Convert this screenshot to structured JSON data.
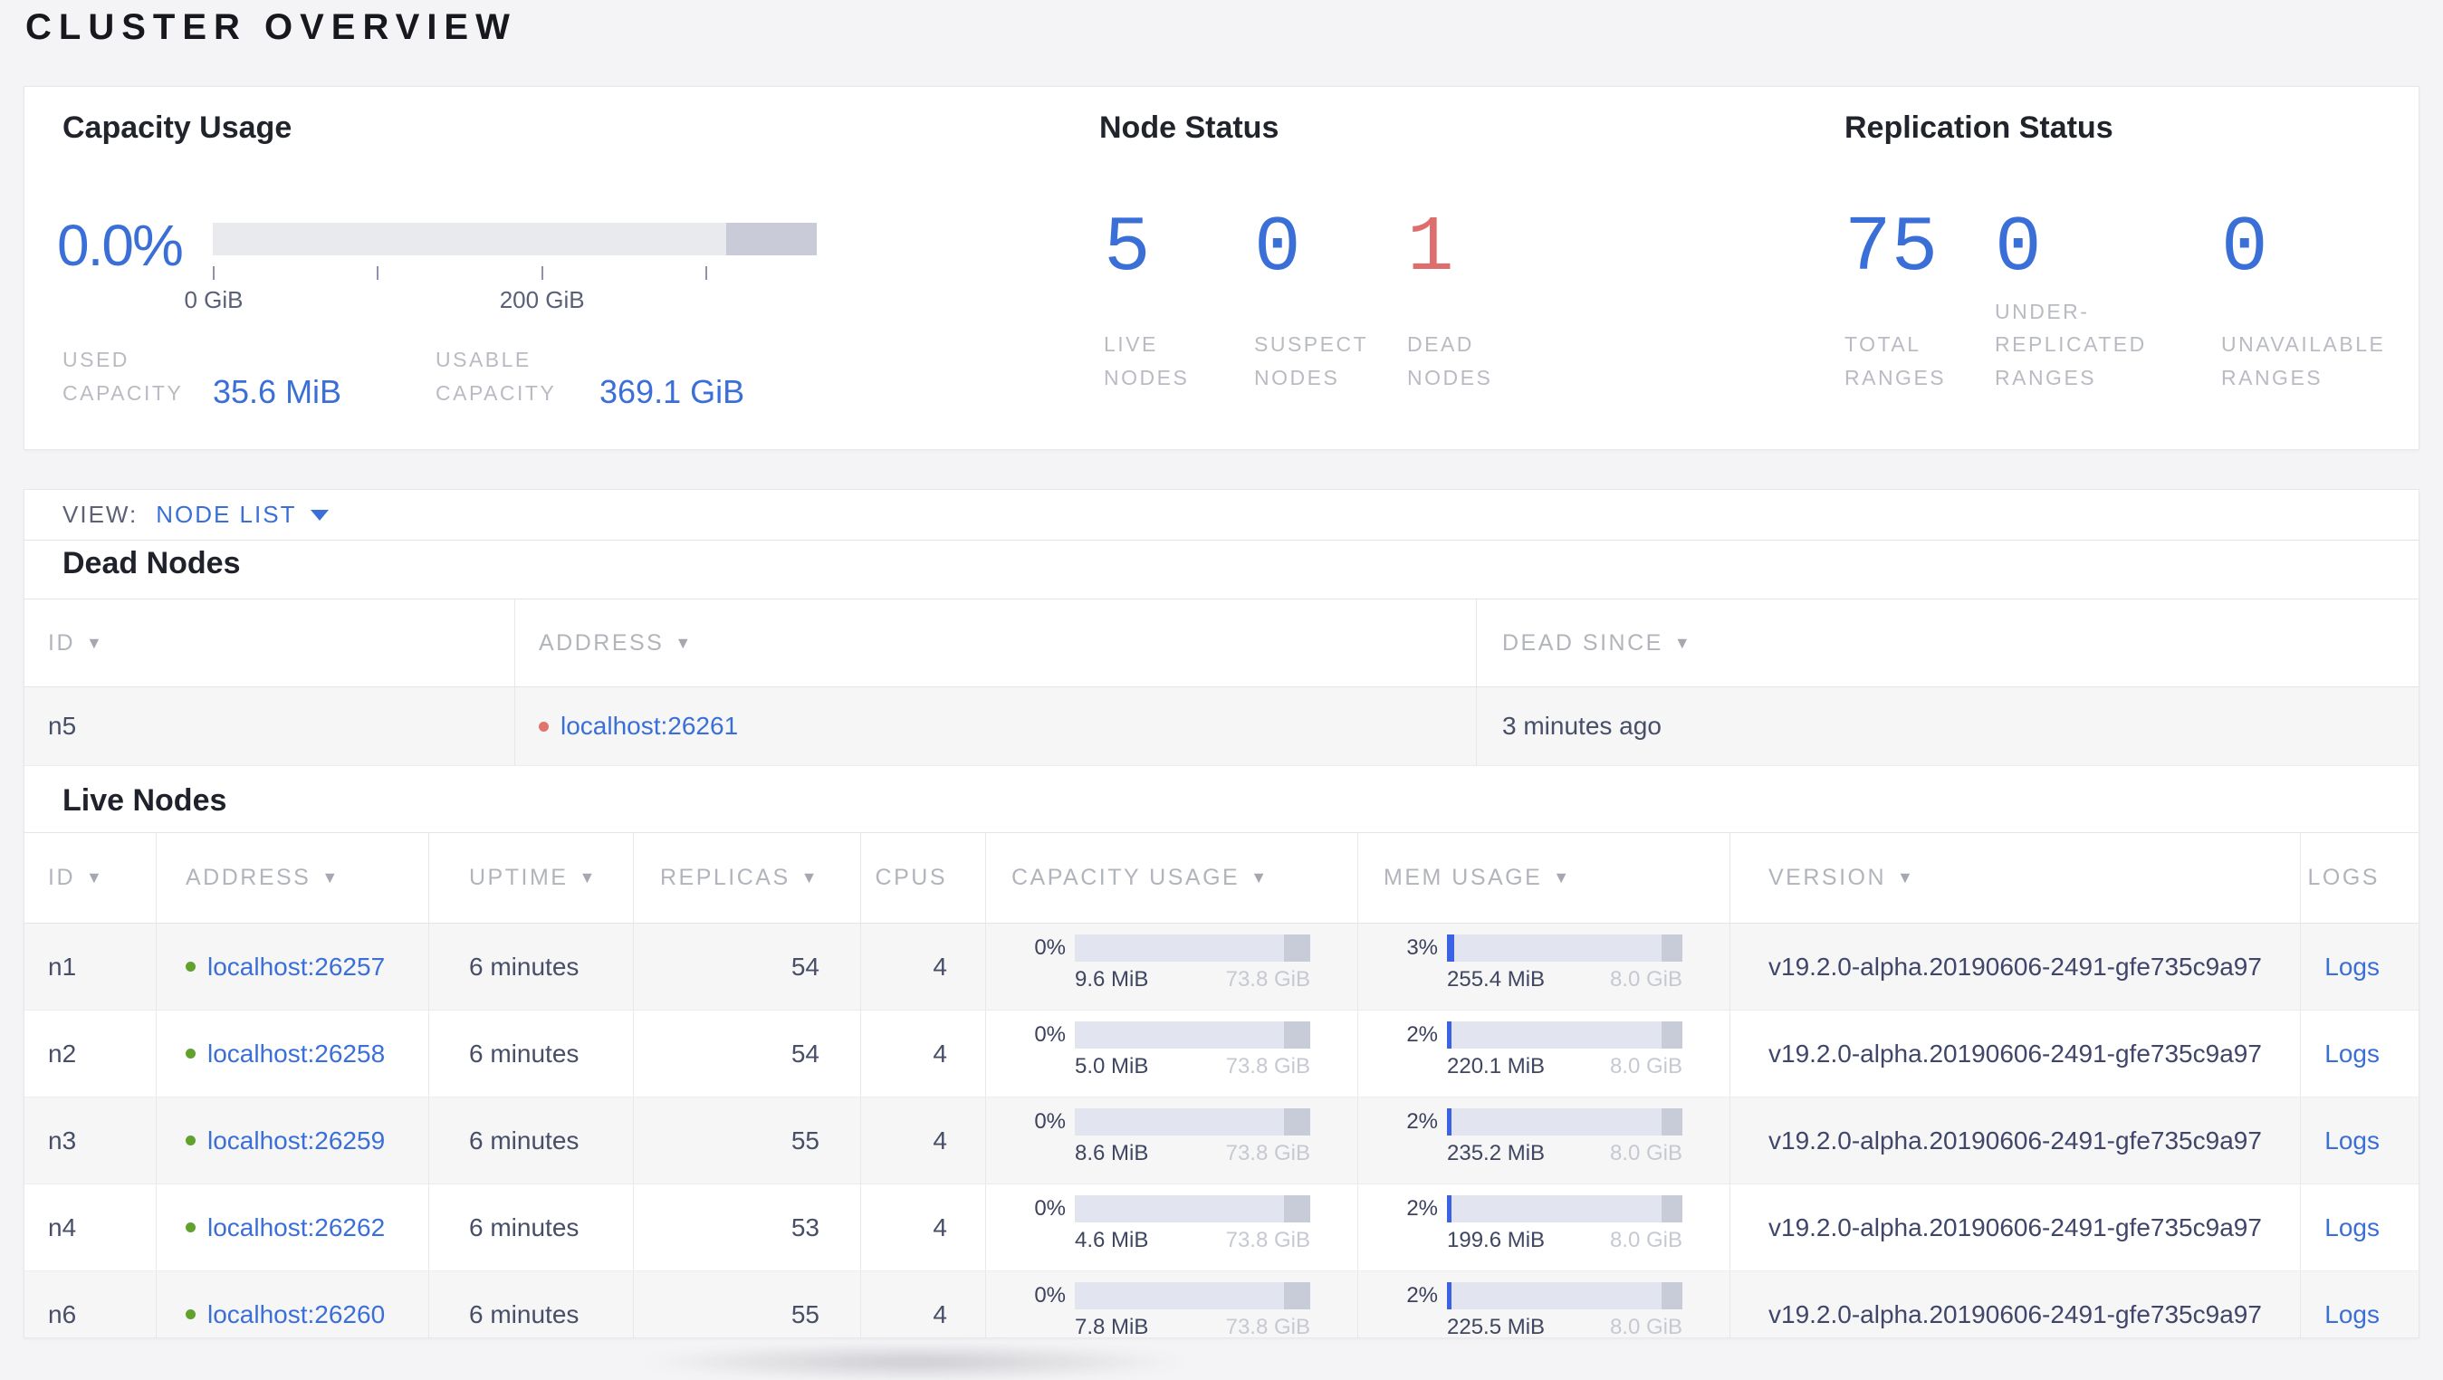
{
  "page": {
    "title": "CLUSTER OVERVIEW"
  },
  "colors": {
    "accent_blue": "#3a6fd8",
    "bar_used_blue": "#3a62e2",
    "danger_red": "#de6e6c",
    "dead_dot_red": "#e0756f",
    "live_dot_green": "#61a22e",
    "bar_track": "#e2e5f0",
    "bar_reserved": "#c8ccd9"
  },
  "summary": {
    "capacity": {
      "title": "Capacity Usage",
      "percent": "0.0%",
      "bar": {
        "used_pct": 0,
        "reserved_pct": 15
      },
      "tick_count": 4,
      "tick_labels": [
        {
          "text": "0 GiB",
          "tick_index": 0
        },
        {
          "text": "200 GiB",
          "tick_index": 2
        }
      ],
      "stats": [
        {
          "label": "USED CAPACITY",
          "value": "35.6 MiB"
        },
        {
          "label": "USABLE CAPACITY",
          "value": "369.1 GiB"
        }
      ]
    },
    "node_status": {
      "title": "Node Status",
      "stats": [
        {
          "label": "LIVE NODES",
          "value": "5",
          "emphasis": "normal"
        },
        {
          "label": "SUSPECT NODES",
          "value": "0",
          "emphasis": "normal"
        },
        {
          "label": "DEAD NODES",
          "value": "1",
          "emphasis": "danger"
        }
      ]
    },
    "replication": {
      "title": "Replication Status",
      "stats": [
        {
          "label": "TOTAL RANGES",
          "value": "75",
          "emphasis": "normal"
        },
        {
          "label": "UNDER-REPLICATED RANGES",
          "value": "0",
          "emphasis": "normal"
        },
        {
          "label": "UNAVAILABLE RANGES",
          "value": "0",
          "emphasis": "normal"
        }
      ]
    }
  },
  "view_bar": {
    "label": "VIEW:",
    "selected": "NODE LIST"
  },
  "dead_nodes": {
    "title": "Dead Nodes",
    "columns": [
      {
        "label": "ID",
        "sort_arrow": true
      },
      {
        "label": "ADDRESS",
        "sort_arrow": true
      },
      {
        "label": "DEAD SINCE",
        "sort_arrow": true
      }
    ],
    "rows": [
      {
        "id": "n5",
        "address": "localhost:26261",
        "status_dot": "red",
        "dead_since": "3 minutes ago"
      }
    ]
  },
  "live_nodes": {
    "title": "Live Nodes",
    "columns": [
      {
        "label": "ID",
        "sort_arrow": true
      },
      {
        "label": "ADDRESS",
        "sort_arrow": true
      },
      {
        "label": "UPTIME",
        "sort_arrow": true
      },
      {
        "label": "REPLICAS",
        "sort_arrow": true
      },
      {
        "label": "CPUS",
        "sort_arrow": false
      },
      {
        "label": "CAPACITY USAGE",
        "sort_arrow": true
      },
      {
        "label": "MEM USAGE",
        "sort_arrow": true
      },
      {
        "label": "VERSION",
        "sort_arrow": true
      },
      {
        "label": "LOGS",
        "sort_arrow": false
      }
    ],
    "logs_label": "Logs",
    "version": "v19.2.0-alpha.20190606-2491-gfe735c9a97",
    "rows": [
      {
        "id": "n1",
        "address": "localhost:26257",
        "status_dot": "green",
        "uptime": "6 minutes",
        "replicas": "54",
        "cpus": "4",
        "capacity": {
          "percent": "0%",
          "used_pct": 0,
          "reserved_pct": 11,
          "used": "9.6 MiB",
          "total": "73.8 GiB"
        },
        "memory": {
          "percent": "3%",
          "used_pct": 3,
          "reserved_pct": 9,
          "used": "255.4 MiB",
          "total": "8.0 GiB"
        }
      },
      {
        "id": "n2",
        "address": "localhost:26258",
        "status_dot": "green",
        "uptime": "6 minutes",
        "replicas": "54",
        "cpus": "4",
        "capacity": {
          "percent": "0%",
          "used_pct": 0,
          "reserved_pct": 11,
          "used": "5.0 MiB",
          "total": "73.8 GiB"
        },
        "memory": {
          "percent": "2%",
          "used_pct": 2,
          "reserved_pct": 9,
          "used": "220.1 MiB",
          "total": "8.0 GiB"
        }
      },
      {
        "id": "n3",
        "address": "localhost:26259",
        "status_dot": "green",
        "uptime": "6 minutes",
        "replicas": "55",
        "cpus": "4",
        "capacity": {
          "percent": "0%",
          "used_pct": 0,
          "reserved_pct": 11,
          "used": "8.6 MiB",
          "total": "73.8 GiB"
        },
        "memory": {
          "percent": "2%",
          "used_pct": 2,
          "reserved_pct": 9,
          "used": "235.2 MiB",
          "total": "8.0 GiB"
        }
      },
      {
        "id": "n4",
        "address": "localhost:26262",
        "status_dot": "green",
        "uptime": "6 minutes",
        "replicas": "53",
        "cpus": "4",
        "capacity": {
          "percent": "0%",
          "used_pct": 0,
          "reserved_pct": 11,
          "used": "4.6 MiB",
          "total": "73.8 GiB"
        },
        "memory": {
          "percent": "2%",
          "used_pct": 2,
          "reserved_pct": 9,
          "used": "199.6 MiB",
          "total": "8.0 GiB"
        }
      },
      {
        "id": "n6",
        "address": "localhost:26260",
        "status_dot": "green",
        "uptime": "6 minutes",
        "replicas": "55",
        "cpus": "4",
        "capacity": {
          "percent": "0%",
          "used_pct": 0,
          "reserved_pct": 11,
          "used": "7.8 MiB",
          "total": "73.8 GiB"
        },
        "memory": {
          "percent": "2%",
          "used_pct": 2,
          "reserved_pct": 9,
          "used": "225.5 MiB",
          "total": "8.0 GiB"
        }
      }
    ]
  }
}
